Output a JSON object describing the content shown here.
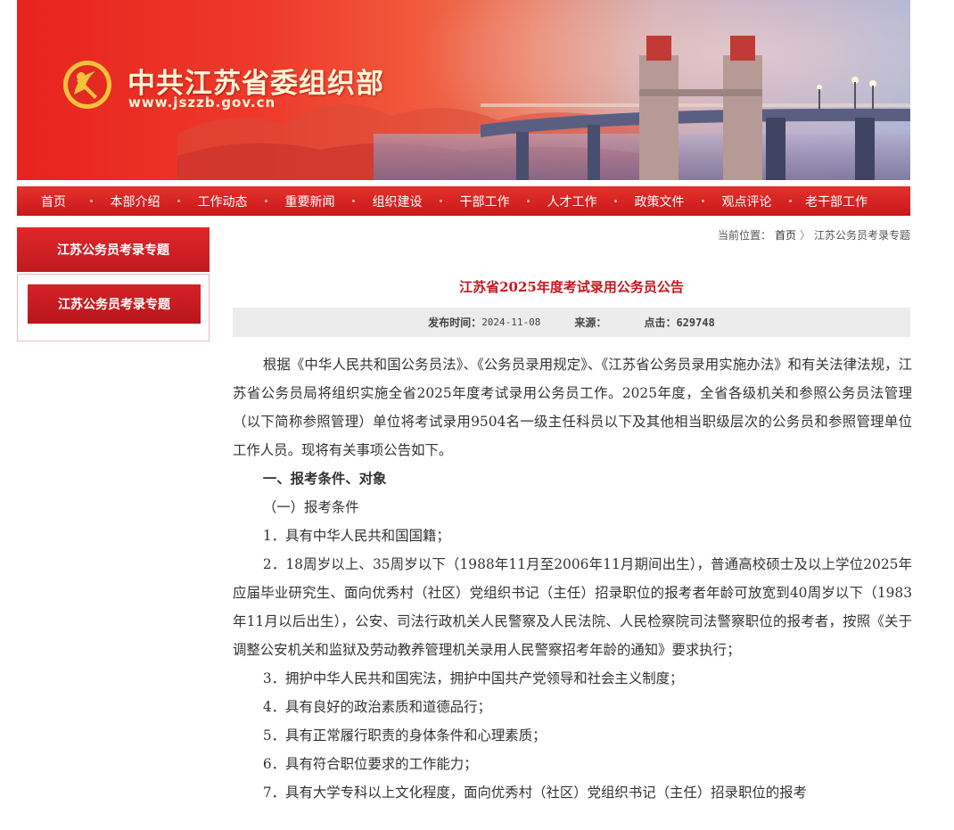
{
  "site": {
    "title": "中共江苏省委组织部",
    "url": "www.jszzb.gov.cn"
  },
  "nav": {
    "items": [
      "首页",
      "本部介绍",
      "工作动态",
      "重要新闻",
      "组织建设",
      "干部工作",
      "人才工作",
      "政策文件",
      "观点评论",
      "老干部工作"
    ]
  },
  "sidebar": {
    "heading": "江苏公务员考录专题",
    "item": "江苏公务员考录专题"
  },
  "breadcrumb": {
    "prefix": "当前位置：",
    "home": "首页",
    "separator": "〉",
    "current": "江苏公务员考录专题"
  },
  "article": {
    "title": "江苏省2025年度考试录用公务员公告",
    "meta": {
      "publish_label": "发布时间：",
      "publish_date": "2024-11-08",
      "source_label": "来源：",
      "source_value": "",
      "clicks_label": "点击：",
      "clicks_value": "629748"
    },
    "paragraphs": [
      "根据《中华人民共和国公务员法》、《公务员录用规定》、《江苏省公务员录用实施办法》和有关法律法规，江苏省公务员局将组织实施全省2025年度考试录用公务员工作。2025年度，全省各级机关和参照公务员法管理（以下简称参照管理）单位将考试录用9504名一级主任科员以下及其他相当职级层次的公务员和参照管理单位工作人员。现将有关事项公告如下。",
      "一、报考条件、对象",
      "（一）报考条件",
      "1．具有中华人民共和国国籍；",
      "2．18周岁以上、35周岁以下（1988年11月至2006年11月期间出生），普通高校硕士及以上学位2025年应届毕业研究生、面向优秀村（社区）党组织书记（主任）招录职位的报考者年龄可放宽到40周岁以下（1983年11月以后出生），公安、司法行政机关人民警察及人民法院、人民检察院司法警察职位的报考者，按照《关于调整公安机关和监狱及劳动教养管理机关录用人民警察招考年龄的通知》要求执行；",
      "3．拥护中华人民共和国宪法，拥护中国共产党领导和社会主义制度；",
      "4．具有良好的政治素质和道德品行；",
      "5．具有正常履行职责的身体条件和心理素质；",
      "6．具有符合职位要求的工作能力；",
      "7．具有大学专科以上文化程度，面向优秀村（社区）党组织书记（主任）招录职位的报考"
    ]
  },
  "colors": {
    "brand_red": "#c8161d",
    "nav_red": "#d42227",
    "meta_bg": "#ececec"
  }
}
